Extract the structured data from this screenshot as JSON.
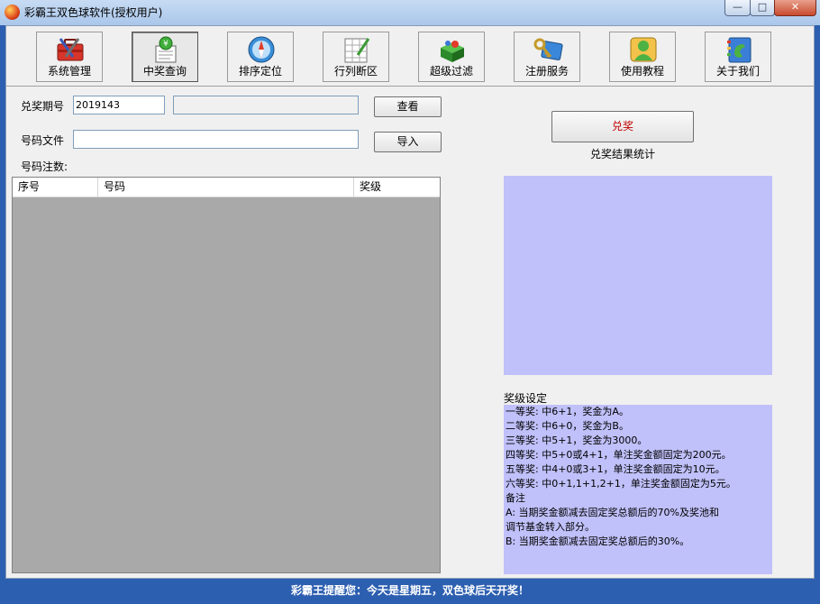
{
  "window": {
    "title": "彩霸王双色球软件(授权用户)",
    "controls": {
      "minimize": "—",
      "maximize": "□",
      "close": "✕"
    }
  },
  "toolbar": {
    "items": [
      {
        "label": "系统管理",
        "icon": "toolbox-icon"
      },
      {
        "label": "中奖查询",
        "icon": "award-check-icon",
        "active": true
      },
      {
        "label": "排序定位",
        "icon": "compass-icon"
      },
      {
        "label": "行列断区",
        "icon": "grid-edit-icon"
      },
      {
        "label": "超级过滤",
        "icon": "filter-box-icon"
      },
      {
        "label": "注册服务",
        "icon": "key-card-icon"
      },
      {
        "label": "使用教程",
        "icon": "users-icon"
      },
      {
        "label": "关于我们",
        "icon": "phone-book-icon"
      }
    ]
  },
  "form": {
    "period_label": "兑奖期号",
    "period_value": "2019143",
    "period_result": "",
    "view_button": "查看",
    "file_label": "号码文件",
    "file_value": "",
    "import_button": "导入",
    "count_label": "号码注数:"
  },
  "list": {
    "columns": [
      "序号",
      "号码",
      "奖级"
    ],
    "rows": []
  },
  "right": {
    "redeem_button": "兑奖",
    "stats_title": "兑奖结果统计",
    "prize_title": "奖级设定",
    "prize_lines": [
      "一等奖: 中6+1，奖金为A。",
      "二等奖: 中6+0，奖金为B。",
      "三等奖: 中5+1，奖金为3000。",
      "四等奖: 中5+0或4+1，单注奖金额固定为200元。",
      "五等奖: 中4+0或3+1，单注奖金额固定为10元。",
      "六等奖: 中0+1,1+1,2+1，单注奖金额固定为5元。",
      "备注",
      "A: 当期奖金额减去固定奖总额后的70%及奖池和",
      "调节基金转入部分。",
      "B: 当期奖金额减去固定奖总额后的30%。"
    ]
  },
  "status": {
    "text": "彩霸王提醒您：今天是星期五，双色球后天开奖！"
  },
  "colors": {
    "accent": "#2d5fb0",
    "panel": "#c0c0fa",
    "list_bg": "#a9a9a9",
    "redeem_text": "#c00000"
  }
}
